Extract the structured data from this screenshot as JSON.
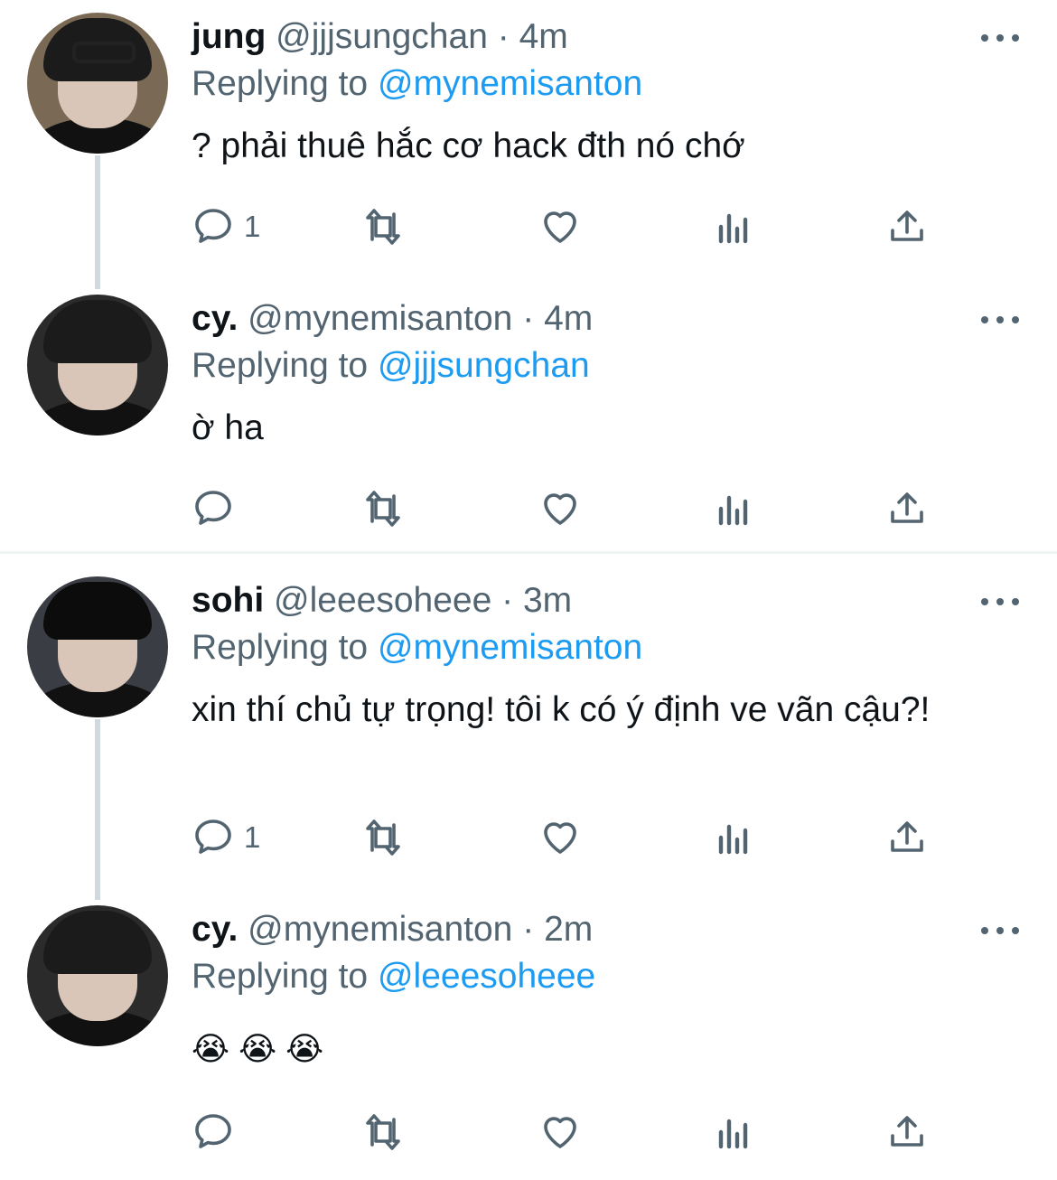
{
  "tweets": [
    {
      "name": "jung",
      "handle": "@jjjsungchan",
      "time": "4m",
      "replying_label": "Replying to",
      "replying_to": "@mynemisanton",
      "text": "? phải thuê hắc cơ hack đth nó chớ",
      "reply_count": "1"
    },
    {
      "name": "cy.",
      "handle": "@mynemisanton",
      "time": "4m",
      "replying_label": "Replying to",
      "replying_to": "@jjjsungchan",
      "text": "ờ ha",
      "reply_count": ""
    },
    {
      "name": "sohi",
      "handle": "@leeesoheee",
      "time": "3m",
      "replying_label": "Replying to",
      "replying_to": "@mynemisanton",
      "text": "xin thí chủ tự trọng! tôi k có ý định ve vãn cậu?!",
      "reply_count": "1"
    },
    {
      "name": "cy.",
      "handle": "@mynemisanton",
      "time": "2m",
      "replying_label": "Replying to",
      "replying_to": "@leeesoheee",
      "text": "😭😭😭",
      "reply_count": ""
    }
  ],
  "separator": "·",
  "icons": {
    "reply": "reply-icon",
    "retweet": "retweet-icon",
    "like": "heart-icon",
    "views": "views-chart-icon",
    "share": "share-icon",
    "more": "more-dots-icon"
  },
  "colors": {
    "mention": "#1d9bf0",
    "secondary_text": "#536471",
    "thread_line": "#cfd9de"
  }
}
